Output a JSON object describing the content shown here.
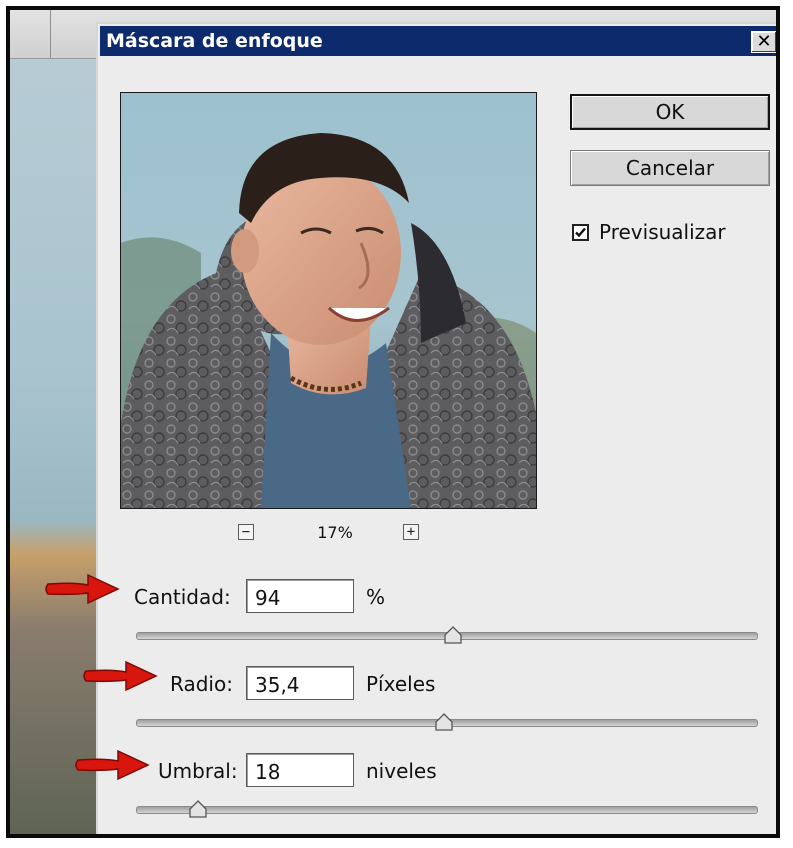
{
  "dialog": {
    "title": "Máscara de enfoque",
    "close_label": "✕"
  },
  "buttons": {
    "ok": "OK",
    "cancel": "Cancelar"
  },
  "preview_checkbox": {
    "label": "Previsualizar",
    "checked": true
  },
  "zoom": {
    "minus": "−",
    "plus": "+",
    "value": "17%"
  },
  "fields": {
    "cantidad": {
      "label": "Cantidad:",
      "value": "94",
      "unit": "%",
      "slider_fraction": 0.51
    },
    "radio": {
      "label": "Radio:",
      "value": "35,4",
      "unit": "Píxeles",
      "slider_fraction": 0.495
    },
    "umbral": {
      "label": "Umbral:",
      "value": "18",
      "unit": "niveles",
      "slider_fraction": 0.1
    }
  },
  "colors": {
    "titlebar": "#0d2a6c",
    "arrow": "#d8160e"
  }
}
